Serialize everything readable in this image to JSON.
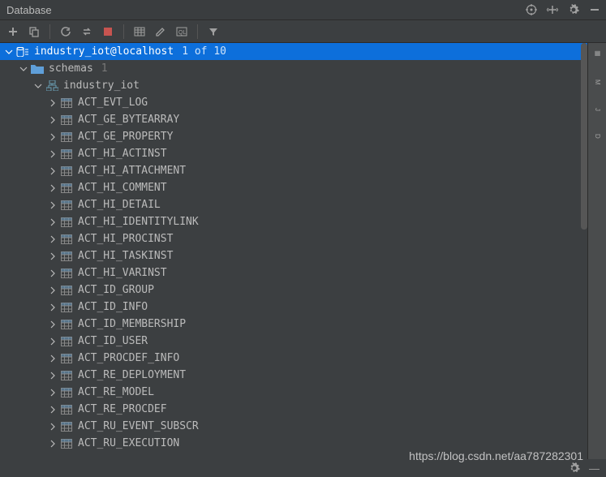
{
  "header": {
    "title": "Database"
  },
  "connection": {
    "label": "industry_iot@localhost",
    "count": "1 of 10"
  },
  "schemas": {
    "label": "schemas",
    "count": "1",
    "items": [
      {
        "name": "industry_iot"
      }
    ]
  },
  "tables": [
    "ACT_EVT_LOG",
    "ACT_GE_BYTEARRAY",
    "ACT_GE_PROPERTY",
    "ACT_HI_ACTINST",
    "ACT_HI_ATTACHMENT",
    "ACT_HI_COMMENT",
    "ACT_HI_DETAIL",
    "ACT_HI_IDENTITYLINK",
    "ACT_HI_PROCINST",
    "ACT_HI_TASKINST",
    "ACT_HI_VARINST",
    "ACT_ID_GROUP",
    "ACT_ID_INFO",
    "ACT_ID_MEMBERSHIP",
    "ACT_ID_USER",
    "ACT_PROCDEF_INFO",
    "ACT_RE_DEPLOYMENT",
    "ACT_RE_MODEL",
    "ACT_RE_PROCDEF",
    "ACT_RU_EVENT_SUBSCR",
    "ACT_RU_EXECUTION"
  ],
  "watermark": "https://blog.csdn.net/aa787282301"
}
